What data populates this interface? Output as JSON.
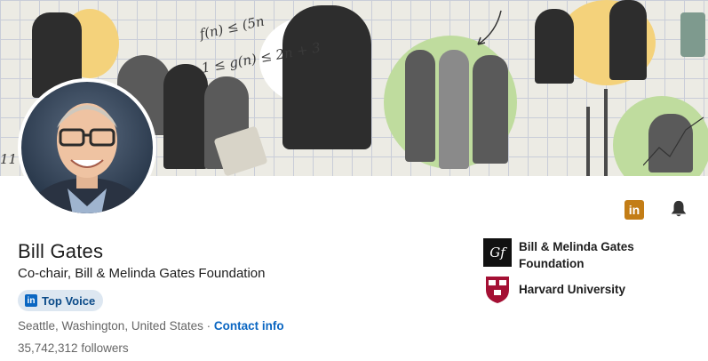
{
  "profile": {
    "name": "Bill Gates",
    "headline": "Co-chair, Bill & Melinda Gates Foundation",
    "badge_label": "Top Voice",
    "badge_icon": "linkedin-icon",
    "location": "Seattle, Washington, United States",
    "separator": "·",
    "contact_label": "Contact info",
    "followers_count": "35,742,312",
    "followers_label": "followers"
  },
  "banner": {
    "math_1": "f(n) ≤ (5n",
    "math_2": "1 ≤ g(n) ≤ 2n + 3",
    "math_3": "11"
  },
  "actions": {
    "linkedin_logo_text": "in",
    "linkedin_icon": "linkedin-icon",
    "bell_icon": "bell-icon"
  },
  "organizations": [
    {
      "name": "Bill & Melinda Gates Foundation",
      "logo_text": "Gf",
      "logo_icon": "gates-foundation-logo"
    },
    {
      "name": "Harvard University",
      "logo_icon": "harvard-shield-logo"
    }
  ],
  "colors": {
    "link": "#0a66c2",
    "badge_bg": "#dde7f1",
    "linkedin_premium": "#c37d16",
    "harvard_crimson": "#a41034"
  }
}
